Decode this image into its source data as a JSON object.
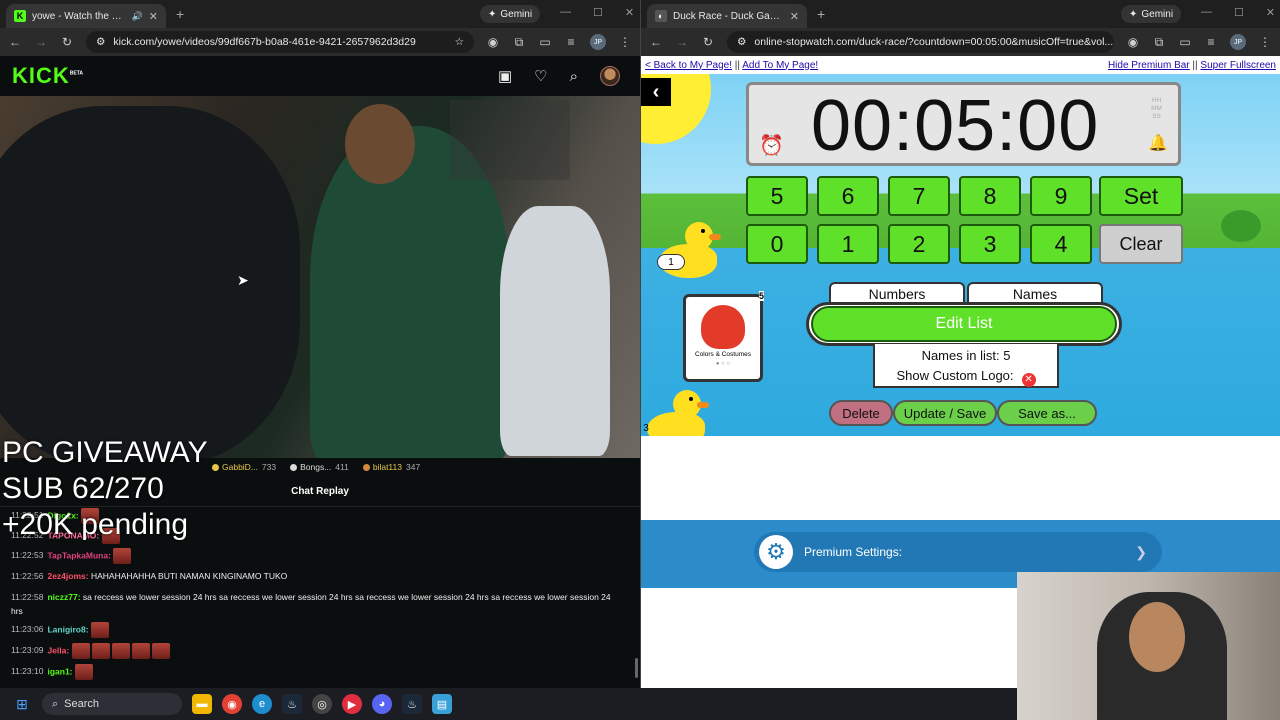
{
  "left_browser": {
    "tab_title": "yowe - Watch the VOD on",
    "gemini_label": "Gemini",
    "url": "kick.com/yowe/videos/99df667b-b0a8-461e-9421-2657962d3d29",
    "profile_initials": "JP",
    "kick": {
      "logo": "KICK",
      "logo_beta": "BETA",
      "overlay_line1": "PC GIVEAWAY",
      "overlay_line2": "SUB 62/270",
      "overlay_line3": "+20K pending",
      "leaderboard": [
        {
          "name": "GabbiD...",
          "count": "733",
          "color": "#e8c547"
        },
        {
          "name": "Bongs...",
          "count": "411",
          "color": "#d9d9d9"
        },
        {
          "name": "bilat113",
          "count": "347",
          "color": "#d48a3a"
        }
      ],
      "chat_title": "Chat Replay",
      "chat": [
        {
          "time": "11:22:51",
          "user": "Digo1x:",
          "color": "#53fc18",
          "text": ""
        },
        {
          "time": "11:22:52",
          "user": "TAPONAMO:",
          "color": "#ff6b9a",
          "text": ""
        },
        {
          "time": "11:22:53",
          "user": "TapTapkaMuna:",
          "color": "#e0427a",
          "text": ""
        },
        {
          "time": "11:22:56",
          "user": "2ez4joms:",
          "color": "#ff4f6a",
          "text": "HAHAHAHAHHA BUTI NAMAN KINGINAMO TUKO"
        },
        {
          "time": "11:22:58",
          "user": "niczz77:",
          "color": "#53fc18",
          "text": "sa reccess we lower session 24 hrs sa reccess we lower session 24 hrs sa reccess we lower session 24 hrs sa reccess we lower session 24 hrs"
        },
        {
          "time": "11:23:06",
          "user": "Lanigiro8:",
          "color": "#5fd4c8",
          "text": ""
        },
        {
          "time": "11:23:09",
          "user": "Jella:",
          "color": "#ff4f6a",
          "text": ""
        },
        {
          "time": "11:23:10",
          "user": "igan1:",
          "color": "#53fc18",
          "text": ""
        }
      ]
    }
  },
  "right_browser": {
    "tab_title": "Duck Race - Duck Games",
    "gemini_label": "Gemini",
    "url": "online-stopwatch.com/duck-race/?countdown=00:05:00&musicOff=true&vol...",
    "profile_initials": "JP",
    "links": {
      "back": "< Back to My Page!",
      "add": "Add To My Page!",
      "hide": "Hide Premium Bar",
      "fullscreen": "Super Fullscreen",
      "sep": "||"
    },
    "timer": "00:05:00",
    "hms": [
      "HH",
      "MM",
      "SS"
    ],
    "keypad_row1": [
      "5",
      "6",
      "7",
      "8",
      "9",
      "Set"
    ],
    "keypad_row2": [
      "0",
      "1",
      "2",
      "3",
      "4",
      "Clear"
    ],
    "duck_numbers": [
      "1",
      "3"
    ],
    "card_label": "Colors & Costumes",
    "card_badge": "5",
    "tabs": [
      "Numbers",
      "Names"
    ],
    "edit_list": "Edit List",
    "names_in_list": "Names in list: 5",
    "show_custom_logo": "Show Custom Logo:",
    "actions": [
      "Delete",
      "Update / Save",
      "Save as..."
    ],
    "premium_settings": "Premium Settings:"
  },
  "taskbar": {
    "search": "Search"
  },
  "colors": {
    "kick_green": "#53fc18",
    "key_green": "#5fe12a",
    "premium_blue": "#2278b4"
  }
}
